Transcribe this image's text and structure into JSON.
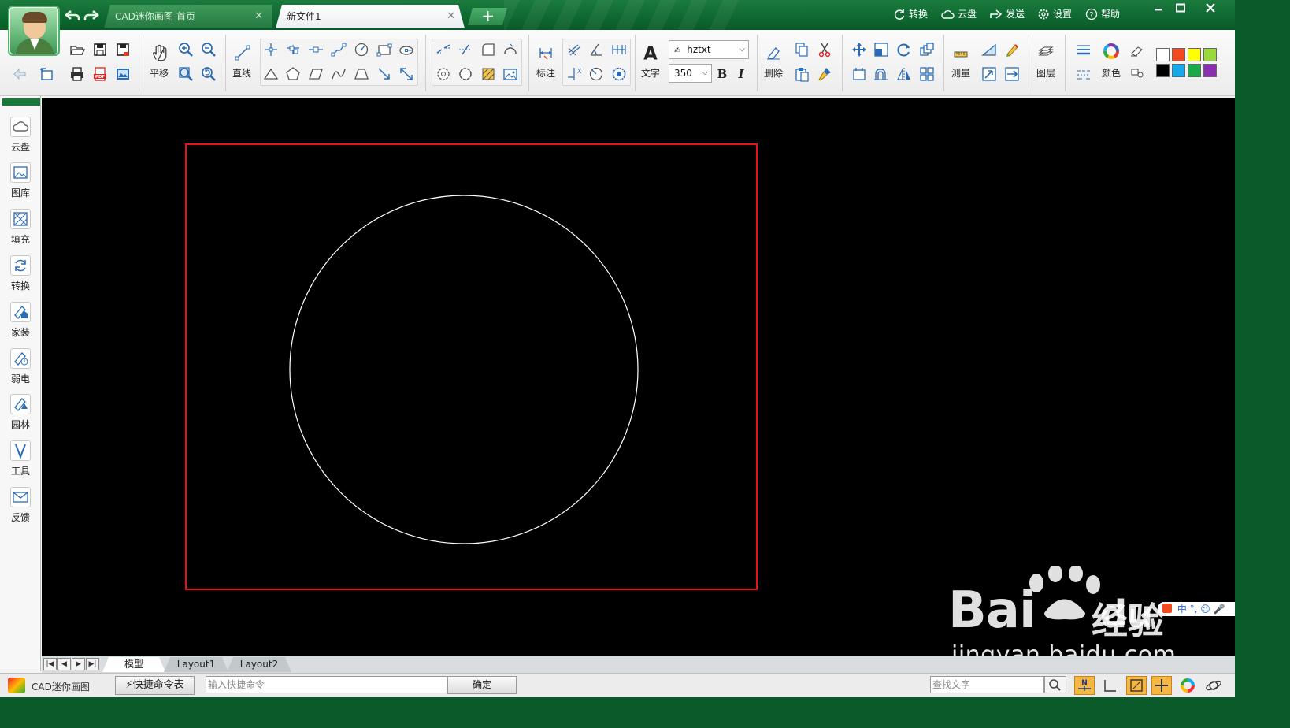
{
  "window": {
    "tabs": [
      {
        "label": "CAD迷你画图-首页",
        "active": false
      },
      {
        "label": "新文件1",
        "active": true
      }
    ],
    "new_tab_label": "+",
    "close_glyph": "✕",
    "top_menu": [
      {
        "icon": "refresh-icon",
        "label": "转换"
      },
      {
        "icon": "cloud-icon",
        "label": "云盘"
      },
      {
        "icon": "send-icon",
        "label": "发送"
      },
      {
        "icon": "gear-icon",
        "label": "设置"
      },
      {
        "icon": "help-icon",
        "label": "帮助"
      }
    ],
    "window_buttons": [
      "minimize",
      "maximize",
      "close"
    ]
  },
  "toolbar": {
    "labels": {
      "pan": "平移",
      "line": "直线",
      "dimension": "标注",
      "text": "文字",
      "delete": "删除",
      "measure": "测量",
      "layer": "图层",
      "color": "颜色"
    },
    "font_name": "hztxt",
    "font_size": "350",
    "bold_label": "B",
    "italic_label": "I",
    "palette": [
      "#ffffff",
      "#f14a1f",
      "#ffff00",
      "#9bd83c",
      "#000000",
      "#19a8e8",
      "#1aaa4a",
      "#8a2fb0"
    ]
  },
  "sidebar": {
    "items": [
      {
        "label": "云盘",
        "icon": "cloud-icon"
      },
      {
        "label": "图库",
        "icon": "image-library-icon"
      },
      {
        "label": "填充",
        "icon": "hatch-icon"
      },
      {
        "label": "转换",
        "icon": "convert-icon"
      },
      {
        "label": "家装",
        "icon": "home-decor-icon"
      },
      {
        "label": "弱电",
        "icon": "low-voltage-icon"
      },
      {
        "label": "园林",
        "icon": "garden-icon"
      },
      {
        "label": "工具",
        "icon": "tools-icon"
      },
      {
        "label": "反馈",
        "icon": "mail-icon"
      }
    ]
  },
  "layout_tabs": [
    {
      "label": "模型",
      "active": true
    },
    {
      "label": "Layout1",
      "active": false
    },
    {
      "label": "Layout2",
      "active": false
    }
  ],
  "statusbar": {
    "app_name": "CAD迷你画图",
    "shortcut_table_label": "快捷命令表",
    "command_placeholder": "输入快捷命令",
    "ok_label": "确定",
    "find_placeholder": "查找文字"
  },
  "watermark": {
    "brand": "Bai",
    "brand_du": "du",
    "brand_cn": "经验",
    "url": "jingyan.baidu.com",
    "ime_text": "中 °, ☺ 🎤"
  },
  "colors": {
    "title_green": "#0f6a31",
    "canvas_bg": "#000000",
    "frame_red": "#e8121b",
    "circle_white": "#ffffff"
  }
}
